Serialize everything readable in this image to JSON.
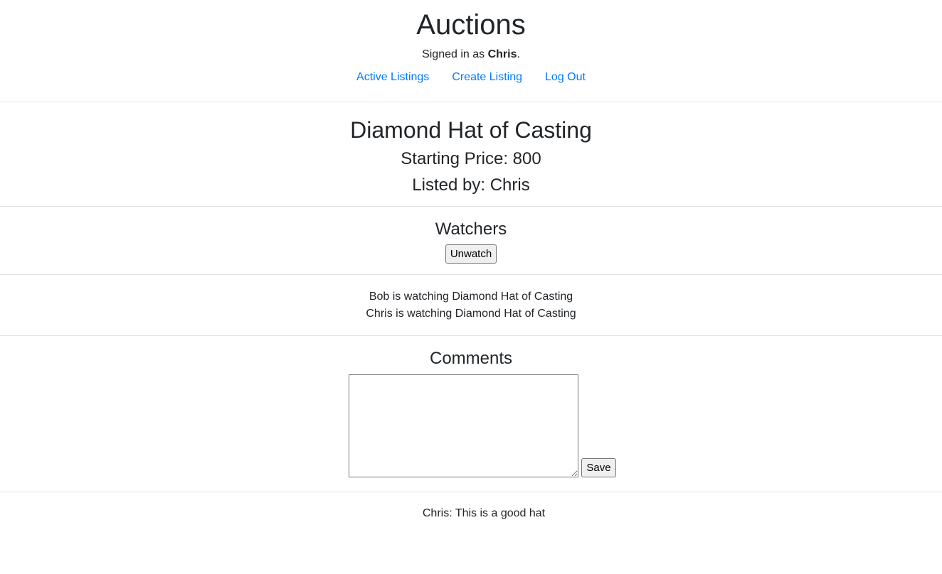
{
  "header": {
    "title": "Auctions",
    "signed_in_prefix": "Signed in as ",
    "username": "Chris",
    "signed_in_suffix": "."
  },
  "nav": {
    "active_listings": "Active Listings",
    "create_listing": "Create Listing",
    "log_out": "Log Out"
  },
  "listing": {
    "title": "Diamond Hat of Casting",
    "starting_price": "Starting Price: 800",
    "listed_by": "Listed by: Chris"
  },
  "watchers": {
    "heading": "Watchers",
    "button_label": "Unwatch",
    "items": [
      "Bob is watching Diamond Hat of Casting",
      "Chris is watching Diamond Hat of Casting"
    ]
  },
  "comments": {
    "heading": "Comments",
    "input_value": "",
    "save_label": "Save",
    "items": [
      "Chris: This is a good hat"
    ]
  },
  "colors": {
    "link": "#007bff",
    "text": "#212529",
    "divider": "#dee2e6"
  }
}
